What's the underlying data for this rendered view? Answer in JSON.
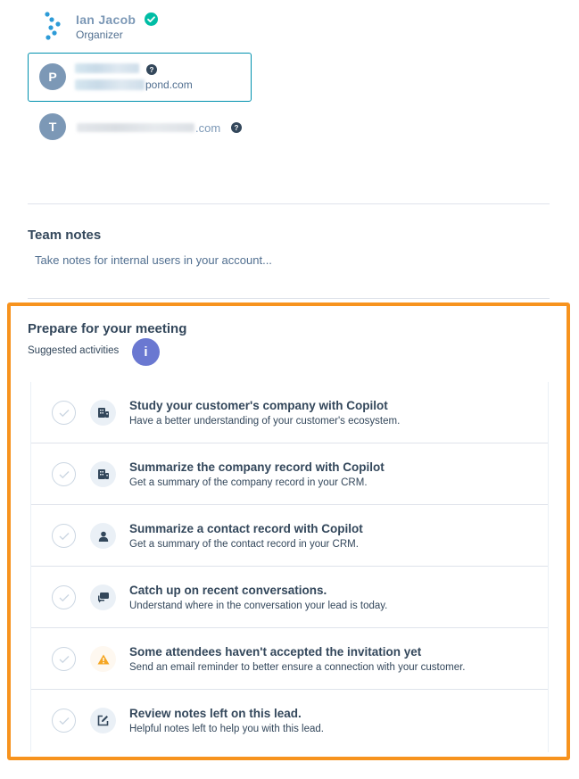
{
  "organizer": {
    "name": "Ian Jacob",
    "role": "Organizer",
    "verified_color": "#00bda5"
  },
  "attendees": [
    {
      "initial": "P",
      "email_suffix": "pond.com",
      "selected": true,
      "help_icon": "question-icon"
    },
    {
      "initial": "T",
      "email_suffix": ".com",
      "selected": false,
      "help_icon": "question-icon"
    }
  ],
  "team_notes": {
    "title": "Team notes",
    "placeholder": "Take notes for internal users in your account..."
  },
  "prepare": {
    "title": "Prepare for your meeting",
    "suggested_label": "Suggested activities",
    "info_badge": "i",
    "highlight_color": "#f7931e",
    "activities": [
      {
        "title": "Study your customer's company with Copilot",
        "description": "Have a better understanding of your customer's ecosystem.",
        "icon": "company-icon"
      },
      {
        "title": "Summarize the company record with Copilot",
        "description": "Get a summary of the company record in your CRM.",
        "icon": "company-icon"
      },
      {
        "title": "Summarize a contact record with Copilot",
        "description": "Get a summary of the contact record in your CRM.",
        "icon": "contact-icon"
      },
      {
        "title": "Catch up on recent conversations.",
        "description": "Understand where in the conversation your lead is today.",
        "icon": "conversations-icon"
      },
      {
        "title": "Some attendees haven't accepted the invitation yet",
        "description": "Send an email reminder to better ensure a connection with your customer.",
        "icon": "warning-icon"
      },
      {
        "title": "Review notes left on this lead.",
        "description": "Helpful notes left to help you with this lead.",
        "icon": "note-edit-icon"
      }
    ]
  }
}
